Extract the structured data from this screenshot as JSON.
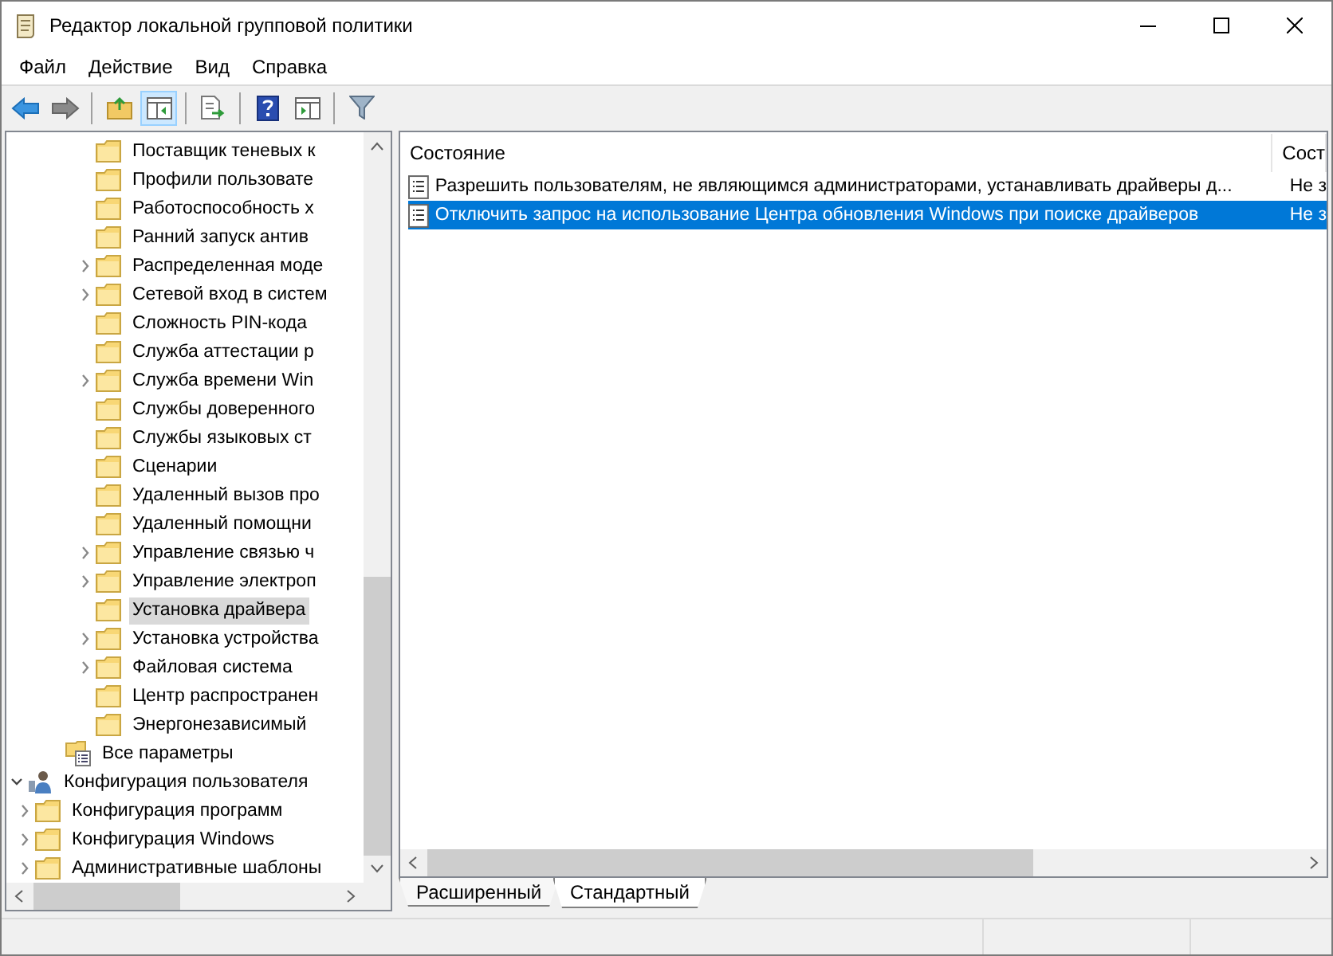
{
  "window": {
    "title": "Редактор локальной групповой политики"
  },
  "menu": [
    "Файл",
    "Действие",
    "Вид",
    "Справка"
  ],
  "toolbar": {
    "console_tree_on": true
  },
  "tree": [
    {
      "children": [
        {
          "children": [
            {
              "children": [
                {
                  "label": "Поставщик теневых к",
                  "has_children": false,
                  "selected": false
                },
                {
                  "label": "Профили пользовате",
                  "has_children": false,
                  "selected": false
                },
                {
                  "label": "Работоспособность х",
                  "has_children": false,
                  "selected": false
                },
                {
                  "label": "Ранний запуск антив",
                  "has_children": false,
                  "selected": false
                },
                {
                  "label": "Распределенная моде",
                  "has_children": true,
                  "selected": false
                },
                {
                  "label": "Сетевой вход в систем",
                  "has_children": true,
                  "selected": false
                },
                {
                  "label": "Сложность PIN-кода",
                  "has_children": false,
                  "selected": false
                },
                {
                  "label": "Служба аттестации р",
                  "has_children": false,
                  "selected": false
                },
                {
                  "label": "Служба времени Win",
                  "has_children": true,
                  "selected": false
                },
                {
                  "label": "Службы доверенного",
                  "has_children": false,
                  "selected": false
                },
                {
                  "label": "Службы языковых ст",
                  "has_children": false,
                  "selected": false
                },
                {
                  "label": "Сценарии",
                  "has_children": false,
                  "selected": false
                },
                {
                  "label": "Удаленный вызов про",
                  "has_children": false,
                  "selected": false
                },
                {
                  "label": "Удаленный помощни",
                  "has_children": false,
                  "selected": false
                },
                {
                  "label": "Управление связью ч",
                  "has_children": true,
                  "selected": false
                },
                {
                  "label": "Управление электроп",
                  "has_children": true,
                  "selected": false
                },
                {
                  "label": "Установка драйвера",
                  "has_children": false,
                  "selected": true
                },
                {
                  "label": "Установка устройства",
                  "has_children": true,
                  "selected": false
                },
                {
                  "label": "Файловая система",
                  "has_children": true,
                  "selected": false
                },
                {
                  "label": "Центр распространен",
                  "has_children": false,
                  "selected": false
                },
                {
                  "label": "Энергонезависимый",
                  "has_children": false,
                  "selected": false
                }
              ]
            },
            {
              "label": "Все параметры",
              "has_children": false,
              "selected": false,
              "kind": "settings"
            }
          ]
        }
      ]
    },
    {
      "label": "Конфигурация пользователя",
      "has_children": true,
      "expanded": true,
      "selected": false,
      "kind": "user",
      "children": [
        {
          "label": "Конфигурация программ",
          "has_children": true,
          "selected": false
        },
        {
          "label": "Конфигурация Windows",
          "has_children": true,
          "selected": false
        },
        {
          "label": "Административные шаблоны",
          "has_children": true,
          "selected": false
        }
      ]
    }
  ],
  "list": {
    "columns": [
      "Состояние",
      "Сост"
    ],
    "rows": [
      {
        "cells": [
          "Разрешить пользователям, не являющимся администраторами, устанавливать драйверы д...",
          "Не з"
        ],
        "selected": false
      },
      {
        "cells": [
          "Отключить запрос на использование Центра обновления Windows при поиске драйверов",
          "Не з"
        ],
        "selected": true
      }
    ]
  },
  "tabs": [
    {
      "label": "Расширенный",
      "selected": false
    },
    {
      "label": "Стандартный",
      "selected": true
    }
  ]
}
